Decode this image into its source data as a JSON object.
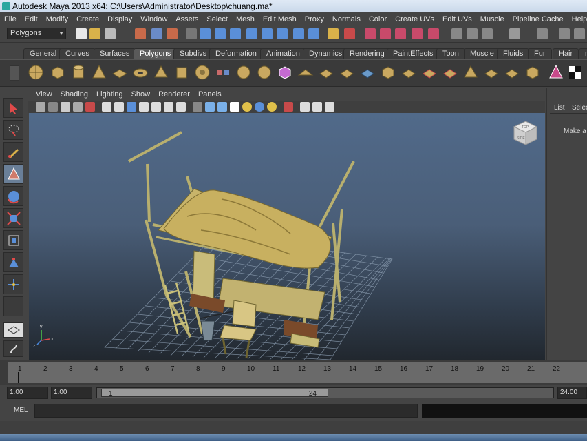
{
  "window": {
    "title": "Autodesk Maya 2013 x64: C:\\Users\\Administrator\\Desktop\\chuang.ma*"
  },
  "menubar": [
    "File",
    "Edit",
    "Modify",
    "Create",
    "Display",
    "Window",
    "Assets",
    "Select",
    "Mesh",
    "Edit Mesh",
    "Proxy",
    "Normals",
    "Color",
    "Create UVs",
    "Edit UVs",
    "Muscle",
    "Pipeline Cache",
    "Help"
  ],
  "statusline": {
    "mode": "Polygons"
  },
  "shelf": {
    "tabs": [
      "General",
      "Curves",
      "Surfaces",
      "Polygons",
      "Subdivs",
      "Deformation",
      "Animation",
      "Dynamics",
      "Rendering",
      "PaintEffects",
      "Toon",
      "Muscle",
      "Fluids",
      "Fur",
      "Hair",
      "n"
    ],
    "active_tab": "Polygons"
  },
  "panel": {
    "menus": [
      "View",
      "Shading",
      "Lighting",
      "Show",
      "Renderer",
      "Panels"
    ],
    "viewcube": {
      "top": "TOP",
      "side": "SIDE"
    },
    "axis": {
      "x": "x",
      "y": "y",
      "z": "z"
    }
  },
  "right_panel": {
    "tabs": [
      "List",
      "Selec"
    ],
    "message": "Make a s"
  },
  "timeslider": {
    "frames": [
      "1",
      "2",
      "3",
      "4",
      "5",
      "6",
      "7",
      "8",
      "9",
      "10",
      "11",
      "12",
      "13",
      "14",
      "15",
      "16",
      "17",
      "18",
      "19",
      "20",
      "21",
      "22"
    ]
  },
  "range": {
    "start": "1.00",
    "current": "1.00",
    "range_start": "1",
    "range_end": "24",
    "end": "24.00"
  },
  "command": {
    "label": "MEL"
  },
  "colors": {
    "viewport_top": "#516a8a",
    "viewport_bottom": "#21272e",
    "bed_cloth": "#c8b060",
    "bed_frame": "#c9c07a",
    "active_tab": "#5a5a5a"
  }
}
